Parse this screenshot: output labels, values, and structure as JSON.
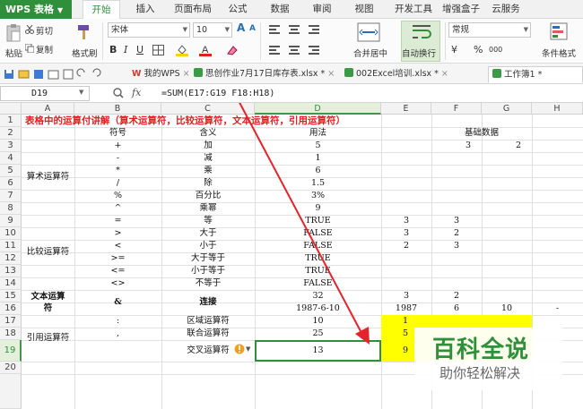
{
  "app": {
    "logo": "WPS 表格",
    "logo_arrow": "▼"
  },
  "menu": [
    "开始",
    "插入",
    "页面布局",
    "公式",
    "数据",
    "审阅",
    "视图",
    "开发工具",
    "增强盒子",
    "云服务"
  ],
  "ribbon": {
    "paste": "粘贴",
    "cut": "剪切",
    "copy": "复制",
    "format_painter": "格式刷",
    "font_name": "宋体",
    "font_size": "10",
    "bold": "B",
    "italic": "I",
    "underline": "U",
    "grow_font": "A",
    "shrink_font": "A",
    "merge_center": "合并居中",
    "wrap": "自动换行",
    "number_format": "常规",
    "currency": "¥",
    "percent": "%",
    "thousands": "000",
    "cond_format": "条件格式"
  },
  "doc_tabs": [
    {
      "label": "我的WPS",
      "close": "×"
    },
    {
      "label": "思创作业7月17日库存表.xlsx *",
      "close": "×"
    },
    {
      "label": "002Excel培训.xlsx *",
      "close": "×"
    },
    {
      "label": "工作簿1 *",
      "close": "",
      "active": true
    }
  ],
  "formula_bar": {
    "cell_ref": "D19",
    "fx": "fx",
    "formula": "=SUM(E17:G19 F18:H18)"
  },
  "columns": [
    "A",
    "B",
    "C",
    "D",
    "E",
    "F",
    "G",
    "H"
  ],
  "selected_column": "D",
  "rows": [
    "1",
    "2",
    "3",
    "4",
    "5",
    "6",
    "7",
    "8",
    "9",
    "10",
    "11",
    "12",
    "13",
    "14",
    "15",
    "16",
    "17",
    "18",
    "19",
    "20"
  ],
  "selected_row": "19",
  "sheet": {
    "title": "表格中的运算付讲解（算术运算符，比较运算符，文本运算符，引用运算符）",
    "header": {
      "b": "符号",
      "c": "含义",
      "d": "用法",
      "ef": "基础数据"
    },
    "row3": {
      "e": "3",
      "f": "2"
    },
    "groups": {
      "arith": "算术运算符",
      "compare": "比较运算符",
      "text": "文本运算\n符",
      "ref": "引用运算符"
    },
    "arith_rows": [
      {
        "b": "+",
        "c": "加",
        "d": "5"
      },
      {
        "b": "-",
        "c": "减",
        "d": "1"
      },
      {
        "b": "*",
        "c": "乘",
        "d": "6"
      },
      {
        "b": "/",
        "c": "除",
        "d": "1.5"
      },
      {
        "b": "%",
        "c": "百分比",
        "d": "3%"
      },
      {
        "b": "^",
        "c": "乘幂",
        "d": "9"
      }
    ],
    "compare_rows": [
      {
        "b": "=",
        "c": "等",
        "d": "TRUE",
        "e": "3",
        "f": "3"
      },
      {
        "b": ">",
        "c": "大于",
        "d": "FALSE",
        "e": "3",
        "f": "2"
      },
      {
        "b": "<",
        "c": "小于",
        "d": "FALSE",
        "e": "2",
        "f": "3"
      },
      {
        "b": ">=",
        "c": "大于等于",
        "d": "TRUE"
      },
      {
        "b": "<=",
        "c": "小于等于",
        "d": "TRUE"
      },
      {
        "b": "<>",
        "c": "不等于",
        "d": "FALSE"
      }
    ],
    "text_rows": {
      "b": "&",
      "c": "连接",
      "d15": "32",
      "e15": "3",
      "f15": "2",
      "d16": "1987-6-10",
      "e16": "1987",
      "f16": "6",
      "g16": "10",
      "h16": "-"
    },
    "ref_rows": [
      {
        "b": ":",
        "c": "区域运算符",
        "d": "10",
        "e": "1"
      },
      {
        "b": ",",
        "c": "联合运算符",
        "d": "25",
        "e": "5"
      },
      {
        "b": "",
        "c": "交叉运算符",
        "d": "13",
        "e": "9"
      }
    ]
  },
  "watermark": {
    "line1": "百科全说",
    "line2": "助你轻松解决"
  },
  "colors": {
    "green": "#2f8f3a",
    "title_red": "#e02020",
    "highlight": "#ffff00",
    "arrow": "#e8222a"
  }
}
